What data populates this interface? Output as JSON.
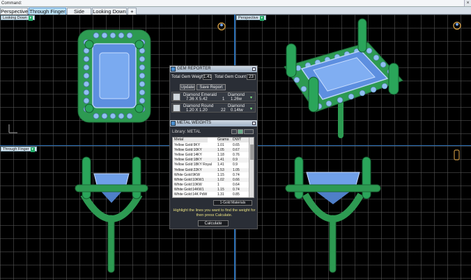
{
  "command_bar": {
    "label": "Command:",
    "close": "×"
  },
  "tabs": [
    {
      "label": "Perspective",
      "active": false
    },
    {
      "label": "Through Finger",
      "active": true
    },
    {
      "label": "Side View",
      "active": false
    },
    {
      "label": "Looking Down",
      "active": false
    },
    {
      "label": "+",
      "active": false
    }
  ],
  "viewports": {
    "top_left": {
      "label": "Looking Down"
    },
    "top_right": {
      "label": "Perspective"
    },
    "bottom_left": {
      "label": "Through Finger"
    },
    "bottom_right": {
      "label": ""
    }
  },
  "gem_reporter": {
    "title": "GEM REPORTER",
    "weight_label": "Total Gem Weight",
    "weight_value": "1.41",
    "count_label": "Total Gem Count",
    "count_value": "23",
    "update_button": "Update",
    "save_button": "Save Report",
    "gems": [
      {
        "name": "Diamond Emerald",
        "size": "7.36 X 5.42",
        "count": "1",
        "type": "Diamond",
        "weight": "1.26w"
      },
      {
        "name": "Diamond Round",
        "size": "1.20 X 1.20",
        "count": "22",
        "type": "Diamond",
        "weight": "0.14tw"
      }
    ]
  },
  "metal_weights": {
    "title": "METAL WEIGHTS",
    "library_label": "Library: METAL",
    "columns": [
      "Metal",
      "Grams",
      "DWT"
    ],
    "rows": [
      [
        "Yellow Gold:9KY",
        "1.01",
        "0.65"
      ],
      [
        "Yellow Gold:10KY",
        "1.05",
        "0.67"
      ],
      [
        "Yellow Gold:14KY",
        "1.18",
        "0.76"
      ],
      [
        "Yellow Gold:18KY",
        "1.41",
        "0.9"
      ],
      [
        "Yellow Gold:18KY Royal",
        "1.41",
        "0.9"
      ],
      [
        "Yellow Gold:22KY",
        "1.53",
        "1.05"
      ],
      [
        "White Gold:9KW",
        "1.15",
        "0.74"
      ],
      [
        "White Gold:10KW1",
        "1.02",
        "0.66"
      ],
      [
        "White Gold:10KW",
        "1",
        "0.64"
      ],
      [
        "White Gold:14KW1",
        "1.15",
        "0.74"
      ],
      [
        "White Gold:14K PdW",
        "1.31",
        "0.85"
      ]
    ],
    "footer_option": "1-Gold Materials",
    "instructions": "Highlight the lines you want to find the weight for then press Calculate.",
    "calculate_button": "Calculate"
  },
  "colors": {
    "prong_green": "#2d9a52",
    "gem_blue": "#6f9fe8",
    "viewport_divider": "#2a6fb5",
    "grid": "#5a5a5a",
    "active_tab": "#bde1f5"
  }
}
